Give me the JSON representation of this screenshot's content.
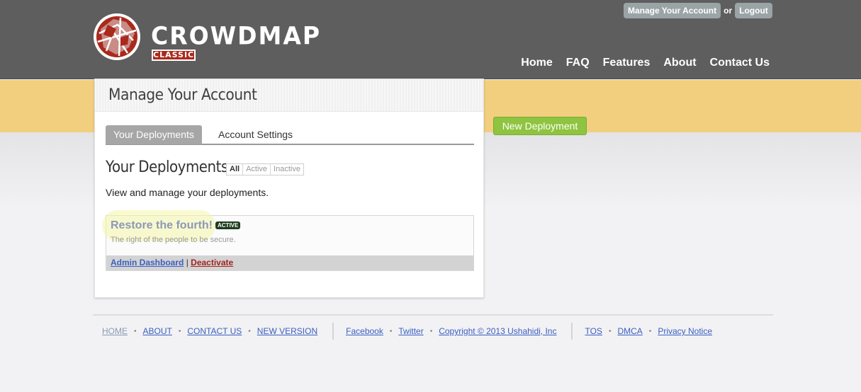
{
  "brand": {
    "wordmark": "CROWDMAP",
    "tag": "CLASSIC"
  },
  "top_links": {
    "manage": "Manage Your Account",
    "or": "or",
    "logout": "Logout"
  },
  "nav": [
    "Home",
    "FAQ",
    "Features",
    "About",
    "Contact Us"
  ],
  "page": {
    "title": "Manage Your Account",
    "tabs": [
      "Your Deployments",
      "Account Settings"
    ],
    "section_title": "Your Deployments",
    "filters": [
      "All",
      "Active",
      "Inactive"
    ],
    "description": "View and manage your deployments."
  },
  "deployment": {
    "name": "Restore the fourth!",
    "status": "ACTIVE",
    "tagline": "The right of the people to be secure.",
    "admin_link": "Admin Dashboard",
    "separator": "|",
    "deactivate_link": "Deactivate"
  },
  "new_deployment_button": "New Deployment",
  "footer": {
    "group1": [
      "HOME",
      "ABOUT",
      "CONTACT US",
      "NEW VERSION"
    ],
    "group2": [
      "Facebook",
      "Twitter",
      "Copyright © 2013 Ushahidi, Inc"
    ],
    "group3": [
      "TOS",
      "DMCA",
      "Privacy Notice"
    ]
  },
  "colors": {
    "header": "#5e5e5e",
    "band": "#f2cf7e",
    "button": "#8ec43f",
    "badge": "#1f3c1f",
    "link": "#3b5fc1",
    "danger": "#a32121"
  },
  "icons": [
    "globe-logo-icon"
  ]
}
